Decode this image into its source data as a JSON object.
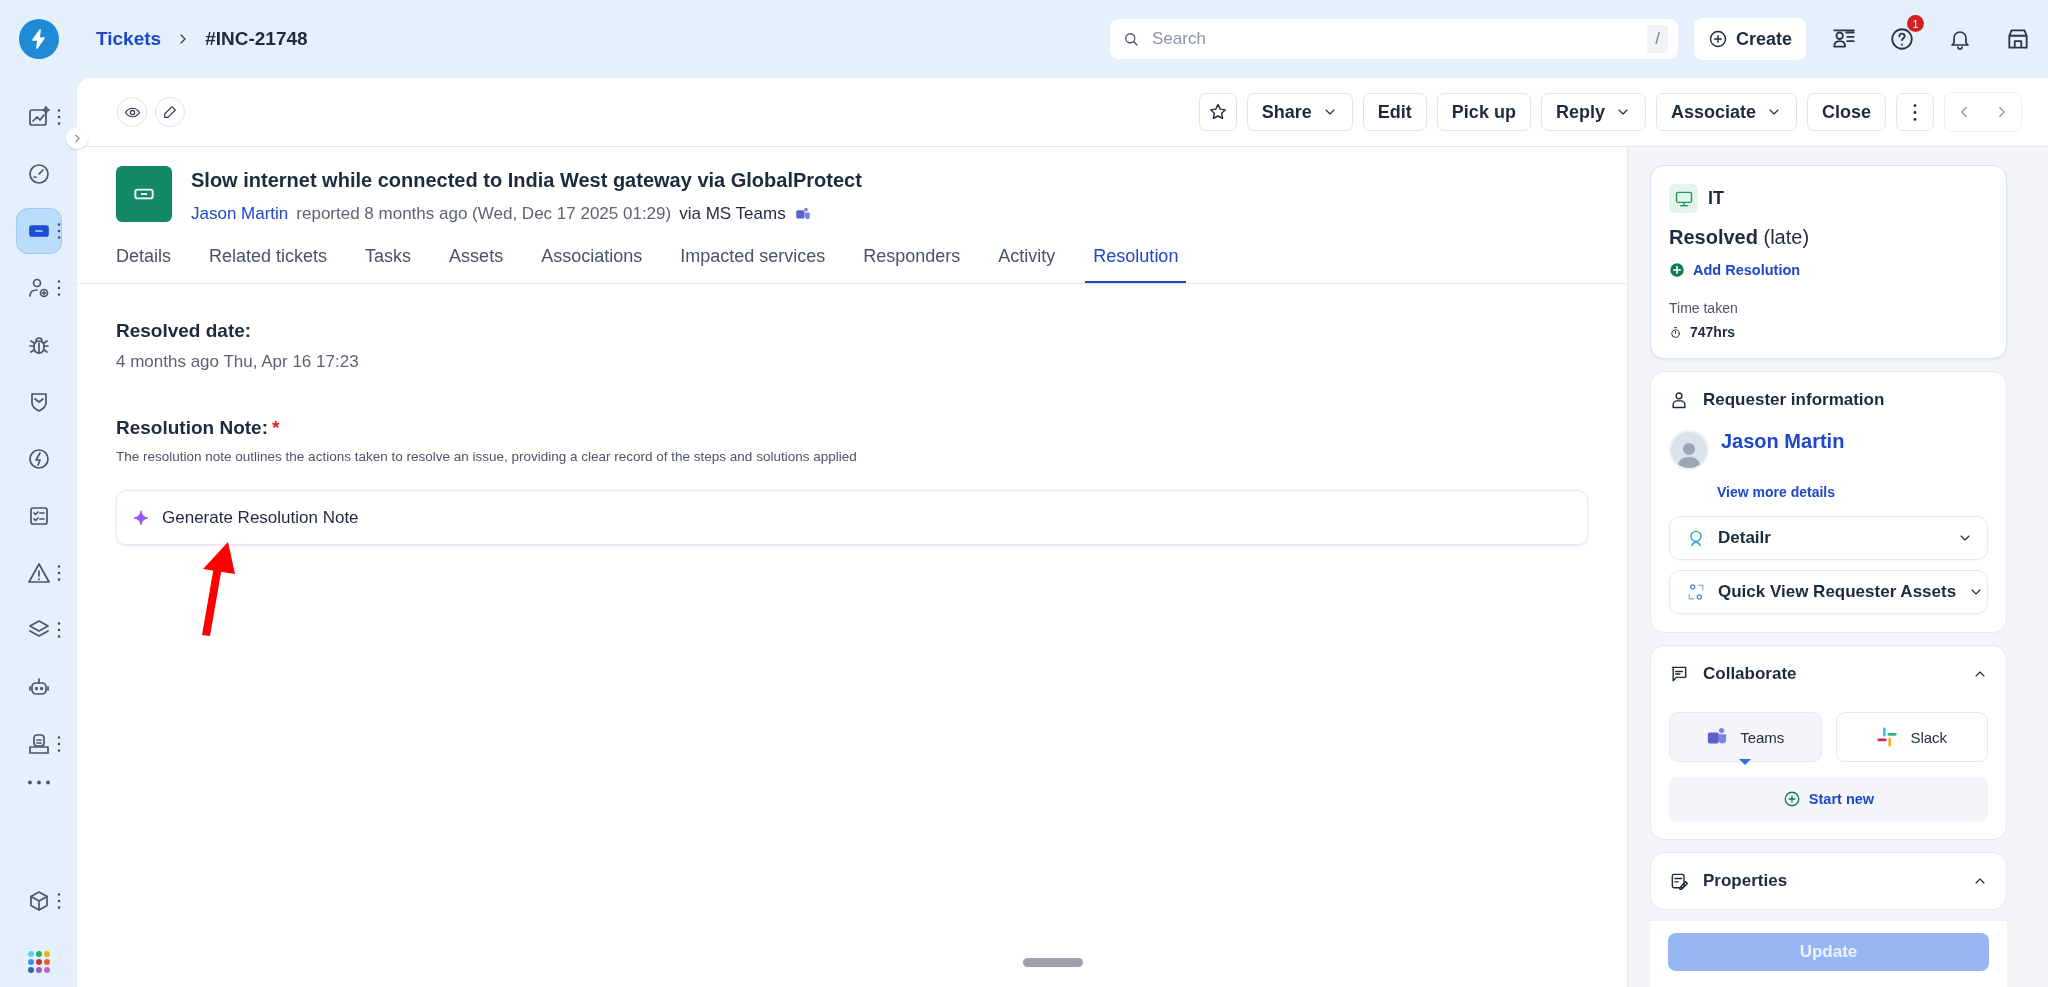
{
  "breadcrumb": {
    "parent": "Tickets",
    "current": "#INC-21748"
  },
  "search": {
    "placeholder": "Search",
    "shortcut": "/"
  },
  "create_button": "Create",
  "help_badge": "1",
  "sidebar": {
    "items": [
      {
        "selected": false,
        "menu": true
      },
      {
        "selected": false,
        "menu": false
      },
      {
        "selected": true,
        "menu": true
      },
      {
        "selected": false,
        "menu": true
      },
      {
        "selected": false,
        "menu": false
      },
      {
        "selected": false,
        "menu": false
      },
      {
        "selected": false,
        "menu": false
      },
      {
        "selected": false,
        "menu": false
      },
      {
        "selected": false,
        "menu": true
      },
      {
        "selected": false,
        "menu": true
      },
      {
        "selected": false,
        "menu": false
      },
      {
        "selected": false,
        "menu": true
      }
    ],
    "bottom_items": [
      {
        "selected": false,
        "menu": true
      }
    ]
  },
  "toolbar": {
    "buttons": [
      {
        "label": "Share",
        "dropdown": true
      },
      {
        "label": "Edit",
        "dropdown": false
      },
      {
        "label": "Pick up",
        "dropdown": false
      },
      {
        "label": "Reply",
        "dropdown": true
      },
      {
        "label": "Associate",
        "dropdown": true
      },
      {
        "label": "Close",
        "dropdown": false
      }
    ]
  },
  "ticket": {
    "title": "Slow internet while connected to India West gateway via GlobalProtect",
    "requester": "Jason Martin",
    "reported": "reported 8 months ago (Wed, Dec 17 2025 01:29)",
    "via": "via MS Teams"
  },
  "tabs": [
    {
      "label": "Details",
      "selected": false
    },
    {
      "label": "Related tickets",
      "selected": false
    },
    {
      "label": "Tasks",
      "selected": false
    },
    {
      "label": "Assets",
      "selected": false
    },
    {
      "label": "Associations",
      "selected": false
    },
    {
      "label": "Impacted services",
      "selected": false
    },
    {
      "label": "Responders",
      "selected": false
    },
    {
      "label": "Activity",
      "selected": false
    },
    {
      "label": "Resolution",
      "selected": true
    }
  ],
  "resolution": {
    "date_label": "Resolved date:",
    "date_value": "4 months ago Thu, Apr 16 17:23",
    "note_label": "Resolution Note:",
    "required_mark": "*",
    "note_hint": "The resolution note outlines the actions taken to resolve an issue, providing a clear record of the steps and solutions applied",
    "generate_button": "Generate Resolution Note"
  },
  "summary_card": {
    "workspace": "IT",
    "status": "Resolved",
    "status_note": "(late)",
    "add_resolution": "Add Resolution",
    "time_label": "Time taken",
    "time_value": "747hrs"
  },
  "requester_card": {
    "title": "Requester information",
    "name": "Jason Martin",
    "view_more": "View more details",
    "sections": [
      {
        "label": "Detailr",
        "expanded": false
      },
      {
        "label": "Quick View Requester Assets",
        "expanded": false
      }
    ]
  },
  "collaborate": {
    "title": "Collaborate",
    "expanded": true,
    "channels": [
      {
        "label": "Teams",
        "selected": true
      },
      {
        "label": "Slack",
        "selected": false
      }
    ],
    "start_new": "Start new"
  },
  "properties": {
    "title": "Properties",
    "expanded": true
  },
  "update_button": {
    "label": "Update",
    "disabled": true
  }
}
